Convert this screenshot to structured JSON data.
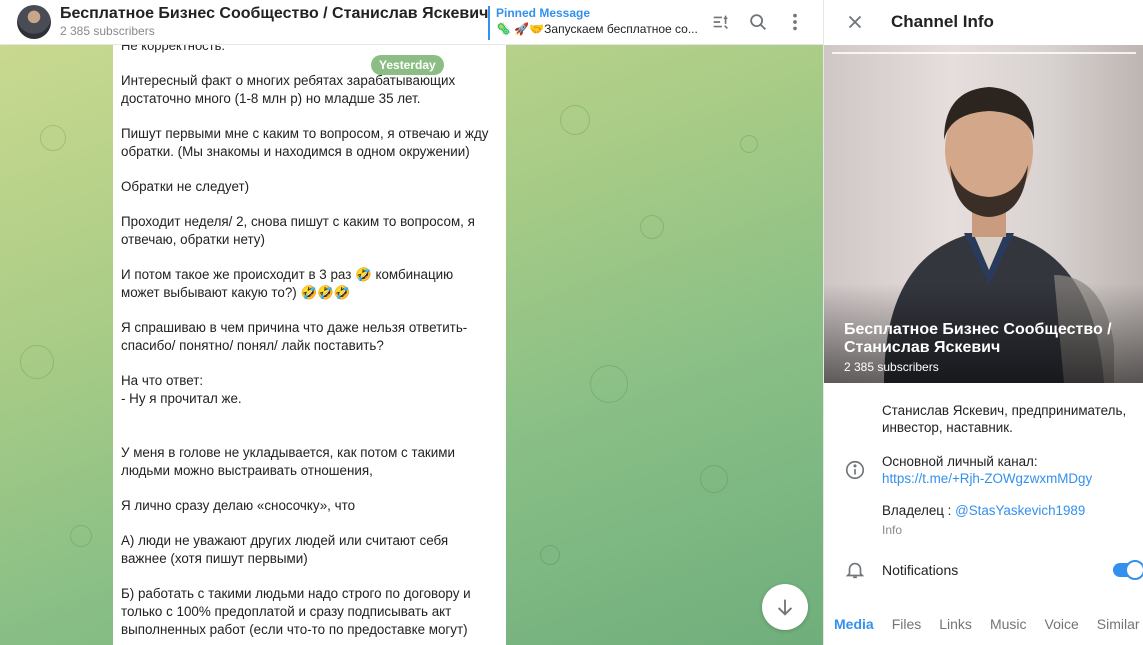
{
  "header": {
    "title": "Бесплатное Бизнес Сообщество / Станислав Яскевич",
    "subscribers": "2 385 subscribers",
    "pinned_label": "Pinned Message",
    "pinned_text": "🦠 🚀🤝Запускаем бесплатное со..."
  },
  "chat": {
    "date_pill": "Yesterday",
    "top_cut_text": "Не корректность.",
    "paragraphs": [
      "Интересный факт о многих ребятах зарабатывающих достаточно много (1-8 млн р) но младше 35 лет.",
      "Пишут первыми мне с каким то вопросом, я отвечаю и жду обратки. (Мы знакомы и находимся в одном окружении)",
      "Обратки не следует)",
      "Проходит неделя/ 2, снова пишут с каким то вопросом, я отвечаю, обратки нету)",
      "И потом такое же происходит в 3 раз 🤣 комбинацию может выбывают какую то?) 🤣🤣🤣",
      "Я спрашиваю в чем причина что даже нельзя ответить- спасибо/ понятно/ понял/ лайк поставить?",
      "На что ответ:\n- Ну я прочитал же.",
      "У меня в голове не укладывается, как потом с такими людьми можно выстраивать отношения,",
      "Я лично сразу делаю «сносочку», что",
      "А) люди не уважают других людей или считают себя важнее (хотя пишут первыми)",
      "Б) работать с такими людьми надо строго по договору и только с 100% предоплатой и сразу подписывать акт выполненных работ (если что-то по предоставке могут)"
    ]
  },
  "info": {
    "title": "Channel Info",
    "photo_name": "Бесплатное Бизнес Сообщество / Станислав Яскевич",
    "photo_subscribers": "2 385 subscribers",
    "description": "Станислав Яскевич, предприниматель, инвестор, наставник.",
    "channel_label": "Основной личный канал:",
    "channel_link": "https://t.me/+Rjh-ZOWgzwxmMDgy",
    "owner_label": "Владелец : ",
    "owner_link": "@StasYaskevich1989",
    "info_caption": "Info",
    "notifications_label": "Notifications",
    "notifications_on": true,
    "tabs": [
      "Media",
      "Files",
      "Links",
      "Music",
      "Voice",
      "Similar"
    ]
  },
  "colors": {
    "accent": "#3390ec",
    "date_pill": "#78b26e"
  }
}
